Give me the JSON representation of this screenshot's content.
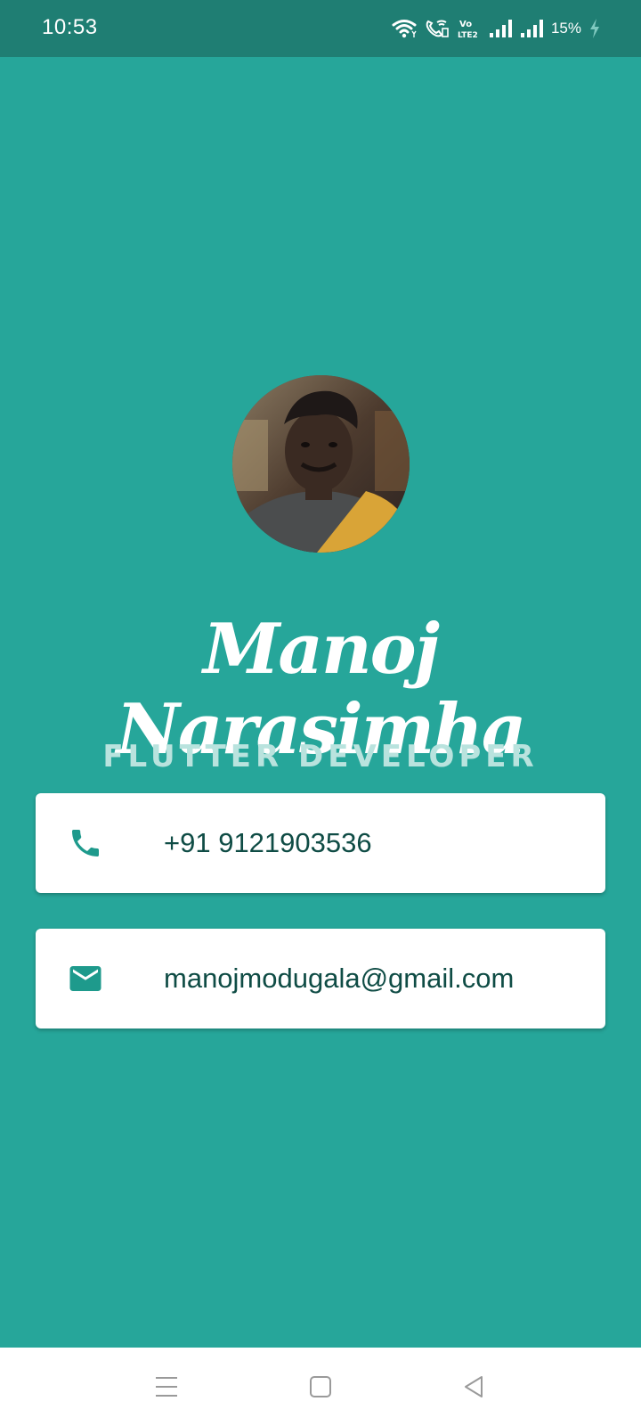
{
  "status_bar": {
    "time": "10:53",
    "battery": "15%",
    "icons": [
      "wifi-icon",
      "wifi-calling-icon",
      "volte-icon",
      "signal-icon",
      "signal-icon",
      "charging-icon"
    ],
    "volte_label": "Vo LTE2"
  },
  "profile": {
    "name": "Manoj Narasimha",
    "title": "FLUTTER DEVELOPER",
    "avatar_icon": "avatar-photo"
  },
  "contacts": {
    "phone": {
      "icon": "phone-icon",
      "value": "+91 9121903536"
    },
    "email": {
      "icon": "email-icon",
      "value": "manojmodugala@gmail.com"
    }
  },
  "navigation": {
    "icons": [
      "menu-icon",
      "home-icon",
      "back-icon"
    ]
  },
  "colors": {
    "background": "#26A69A",
    "status_bar": "#1F7E73",
    "card": "#FFFFFF",
    "card_text": "#0F4C45",
    "icon_teal": "#1E9A8C",
    "subtitle": "#B9E3DE"
  }
}
